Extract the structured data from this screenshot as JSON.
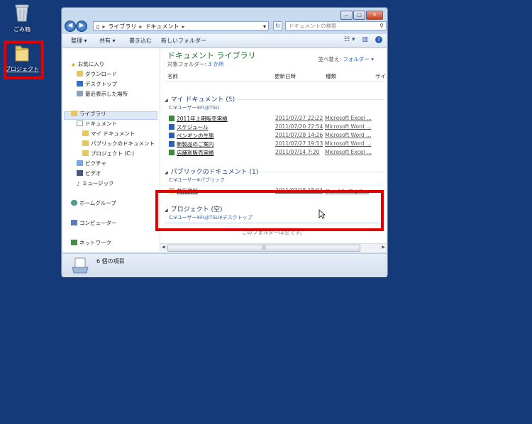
{
  "desktop": {
    "recycle_label": "ごみ箱",
    "project_label": "プロジェクト"
  },
  "window": {
    "address": [
      "ライブラリ",
      "ドキュメント"
    ],
    "search_placeholder": "ドキュメントの検索",
    "toolbar": {
      "organize": "整理 ▾",
      "share": "共有 ▾",
      "burn": "書き込む",
      "new_folder": "新しいフォルダー"
    },
    "nav": {
      "favorites": "お気に入り",
      "downloads": "ダウンロード",
      "desktop": "デスクトップ",
      "recent": "最近表示した場所",
      "libraries": "ライブラリ",
      "documents": "ドキュメント",
      "my_documents": "マイ ドキュメント",
      "public_documents": "パブリックのドキュメント",
      "project_c": "プロジェクト (C:)",
      "pictures": "ピクチャ",
      "videos": "ビデオ",
      "music": "ミュージック",
      "homegroup": "ホームグループ",
      "computer": "コンピューター",
      "network": "ネットワーク"
    },
    "content": {
      "library_title": "ドキュメント ライブラリ",
      "target_prefix": "対象フォルダー: ",
      "target_count": "3 か所",
      "arrange_prefix": "並べ替え: ",
      "arrange_value": "フォルダー ▾",
      "columns": {
        "name": "名前",
        "date": "更新日時",
        "type": "種類",
        "size": "サイ"
      },
      "groups": [
        {
          "title": "マイ ドキュメント (5)",
          "path": "C:¥ユーザー¥FUJITSU",
          "files": [
            {
              "name": "2011年上期販売実績",
              "date": "2011/07/27 22:22",
              "type": "Microsoft Excel ..."
            },
            {
              "name": "スケジュール",
              "date": "2011/07/20 22:54",
              "type": "Microsoft Word ..."
            },
            {
              "name": "ペンギンの生態",
              "date": "2011/07/28 14:26",
              "type": "Microsoft Word ..."
            },
            {
              "name": "新製品のご案内",
              "date": "2011/07/27 19:53",
              "type": "Microsoft Word ..."
            },
            {
              "name": "店舗別販売実績",
              "date": "2011/07/14 7:20",
              "type": "Microsoft Excel ..."
            }
          ]
        },
        {
          "title": "パブリックのドキュメント (1)",
          "path": "C:¥ユーザー¥パブリック",
          "files": [
            {
              "name": "共有資料",
              "date": "2011/07/28 18:04",
              "type": "ファイル フォル..."
            }
          ]
        },
        {
          "title": "プロジェクト (空)",
          "path": "C:¥ユーザー¥FUJITSU¥デスクトップ",
          "empty_text": "このフォルダーは空です。"
        }
      ]
    },
    "status": {
      "items": "6 個の項目"
    }
  },
  "colors": {
    "desktop_bg": "#143a7a",
    "highlight": "#e00000",
    "library_title": "#1e6f2d"
  }
}
